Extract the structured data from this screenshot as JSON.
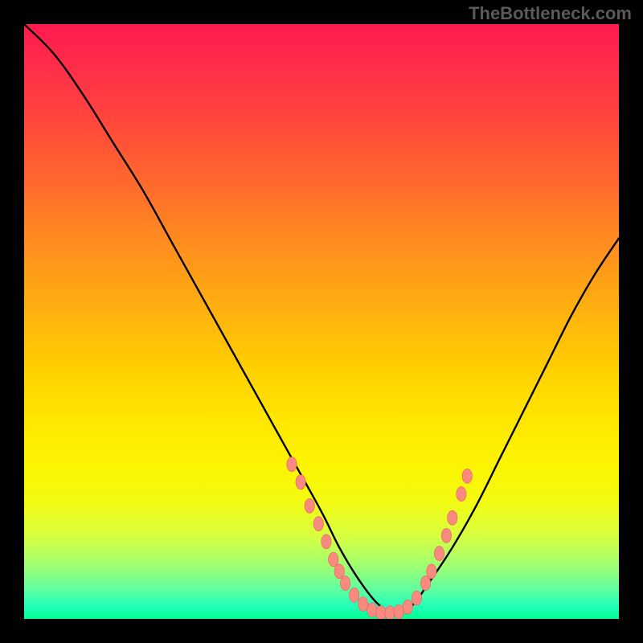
{
  "watermark": "TheBottleneck.com",
  "colors": {
    "curve": "#000000",
    "dot_fill": "#f88a80",
    "dot_stroke": "#e86055"
  },
  "chart_data": {
    "type": "line",
    "title": "",
    "xlabel": "",
    "ylabel": "",
    "xlim": [
      0,
      100
    ],
    "ylim": [
      0,
      100
    ],
    "notes": "Vertical gradient background from red (top, high bottleneck) to green (bottom, balanced). Two black curves descend to a minimum near x≈60 and rise again. Coral dots highlight the low-bottleneck region on both flanks of the valley.",
    "series": [
      {
        "name": "curve_left",
        "x": [
          0,
          5,
          10,
          15,
          20,
          25,
          30,
          35,
          40,
          45,
          50,
          53,
          56,
          59,
          62
        ],
        "y": [
          100,
          95,
          88,
          80,
          72,
          63,
          54,
          45,
          36,
          27,
          18,
          12,
          7,
          3,
          0.5
        ]
      },
      {
        "name": "curve_right",
        "x": [
          62,
          65,
          68,
          72,
          76,
          80,
          84,
          88,
          92,
          96,
          100
        ],
        "y": [
          0.5,
          2,
          6,
          12,
          19,
          27,
          35,
          43,
          51,
          58,
          64
        ]
      }
    ],
    "dots": [
      {
        "x": 45.0,
        "y": 26
      },
      {
        "x": 46.5,
        "y": 23
      },
      {
        "x": 48.0,
        "y": 19
      },
      {
        "x": 49.5,
        "y": 16
      },
      {
        "x": 50.8,
        "y": 13
      },
      {
        "x": 52.0,
        "y": 10
      },
      {
        "x": 53.0,
        "y": 8
      },
      {
        "x": 54.0,
        "y": 6
      },
      {
        "x": 55.5,
        "y": 4
      },
      {
        "x": 57.0,
        "y": 2.5
      },
      {
        "x": 58.5,
        "y": 1.5
      },
      {
        "x": 60.0,
        "y": 1
      },
      {
        "x": 61.5,
        "y": 1
      },
      {
        "x": 63.0,
        "y": 1.2
      },
      {
        "x": 64.5,
        "y": 2
      },
      {
        "x": 66.0,
        "y": 3.5
      },
      {
        "x": 67.5,
        "y": 6
      },
      {
        "x": 68.5,
        "y": 8
      },
      {
        "x": 69.8,
        "y": 11
      },
      {
        "x": 71.0,
        "y": 14
      },
      {
        "x": 72.0,
        "y": 17
      },
      {
        "x": 73.5,
        "y": 21
      },
      {
        "x": 74.5,
        "y": 24
      }
    ]
  }
}
